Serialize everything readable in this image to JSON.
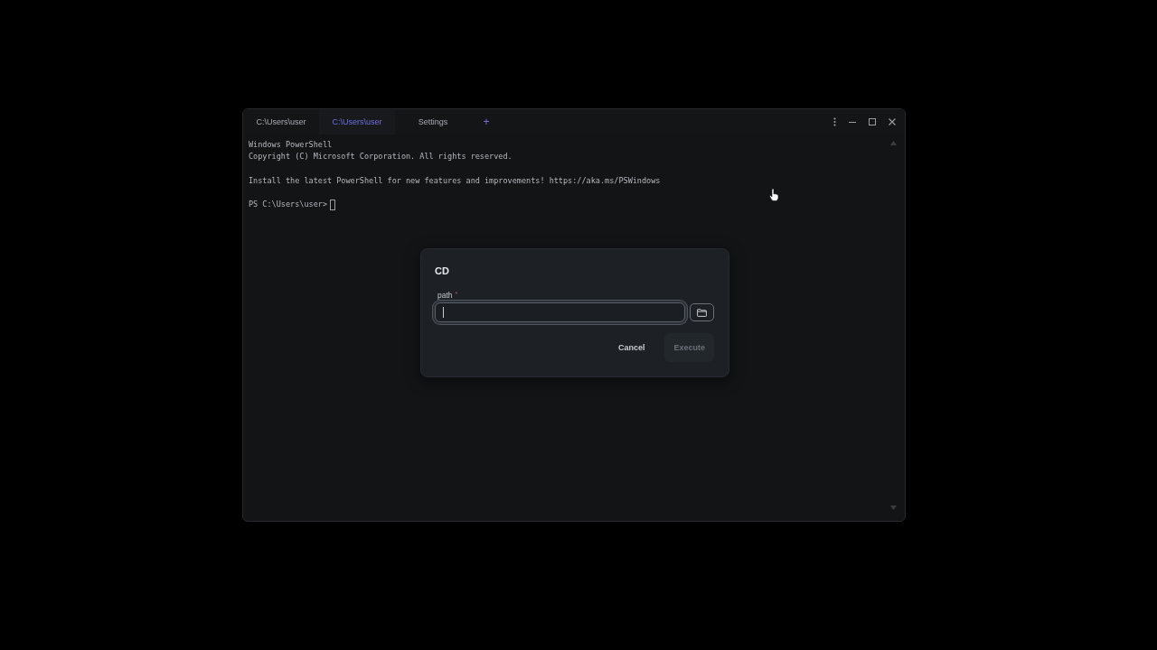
{
  "window": {
    "tabs": [
      {
        "label": "C:\\Users\\user",
        "selected": false
      },
      {
        "label": "C:\\Users\\user",
        "selected": true
      },
      {
        "label": "Settings",
        "selected": false
      }
    ],
    "new_tab": "+"
  },
  "terminal": {
    "blocks": [
      [
        "Windows PowerShell",
        "Copyright (C) Microsoft Corporation. All rights reserved."
      ],
      [
        "Install the latest PowerShell for new features and improvements! https://aka.ms/PSWindows"
      ]
    ],
    "prompt": "PS C:\\Users\\user>"
  },
  "dialog": {
    "title": "CD",
    "fields": [
      {
        "label": "path",
        "required_mark": "*",
        "focused": true
      }
    ],
    "buttons": [
      {
        "label": "Cancel",
        "kind": "text",
        "disabled": false
      },
      {
        "label": "Execute",
        "kind": "primary",
        "disabled": true
      }
    ]
  }
}
